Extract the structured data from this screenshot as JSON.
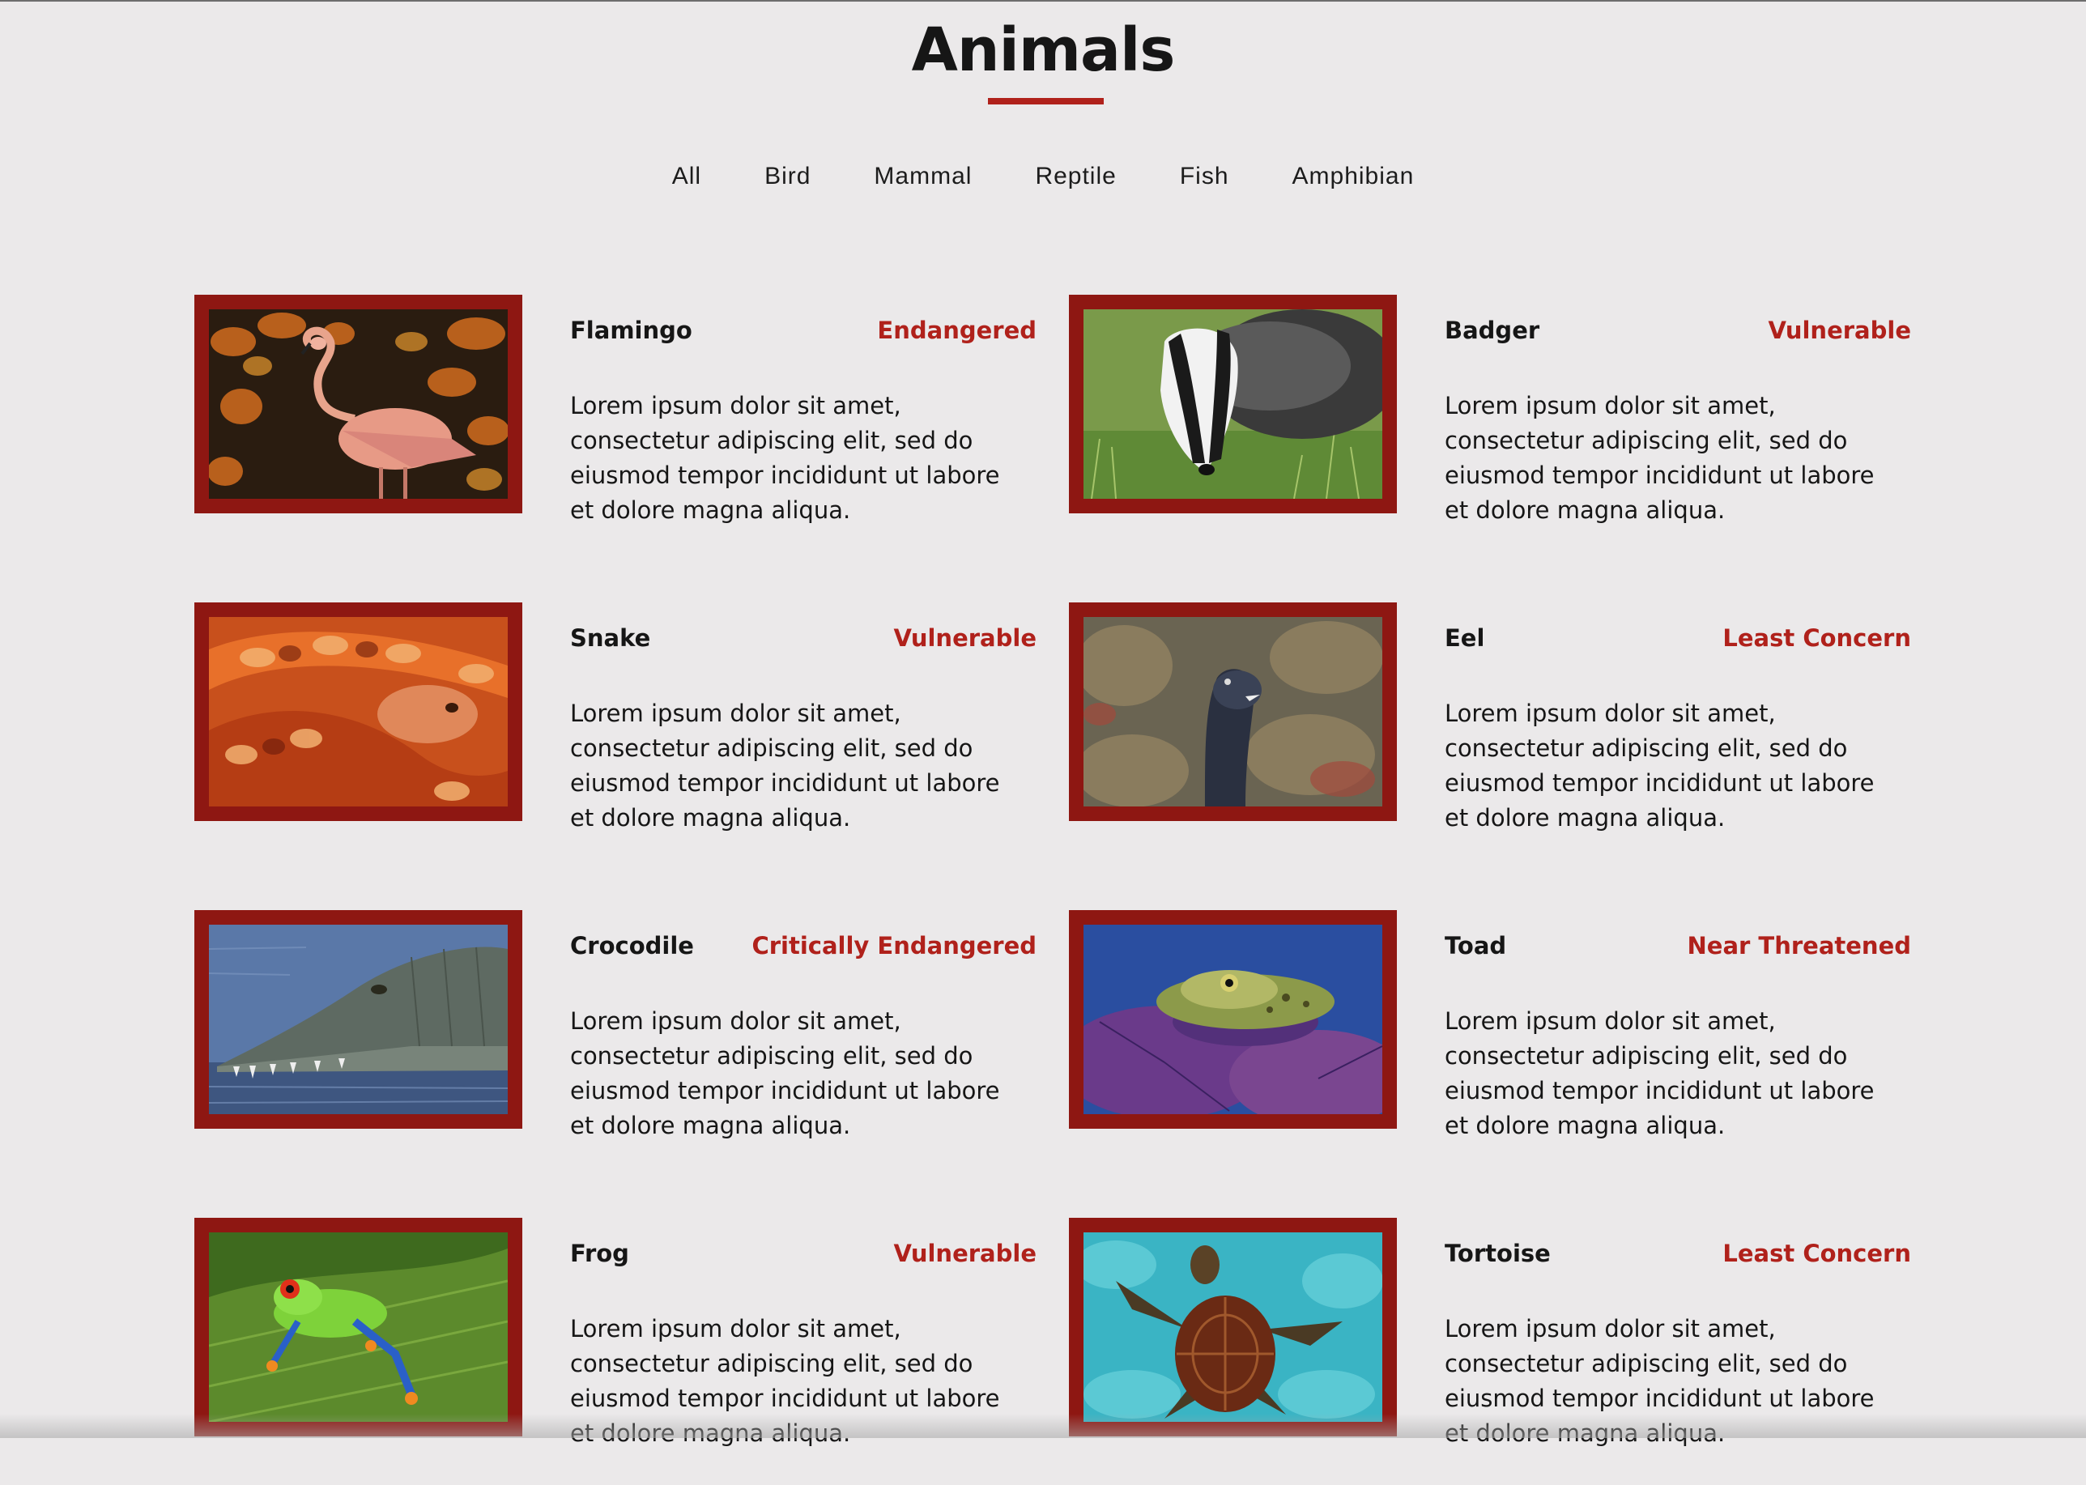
{
  "page": {
    "title": "Animals",
    "accent_color": "#b0211b",
    "frame_color": "#8e1712",
    "background_color": "#ebe9ea"
  },
  "filters": [
    {
      "label": "All"
    },
    {
      "label": "Bird"
    },
    {
      "label": "Mammal"
    },
    {
      "label": "Reptile"
    },
    {
      "label": "Fish"
    },
    {
      "label": "Amphibian"
    }
  ],
  "animals": [
    {
      "name": "Flamingo",
      "status": "Endangered",
      "description": "Lorem ipsum dolor sit amet, consectetur adipiscing elit, sed do eiusmod tempor incididunt ut labore et dolore magna aliqua.",
      "image": "flamingo-photo"
    },
    {
      "name": "Badger",
      "status": "Vulnerable",
      "description": "Lorem ipsum dolor sit amet, consectetur adipiscing elit, sed do eiusmod tempor incididunt ut labore et dolore magna aliqua.",
      "image": "badger-photo"
    },
    {
      "name": "Snake",
      "status": "Vulnerable",
      "description": "Lorem ipsum dolor sit amet, consectetur adipiscing elit, sed do eiusmod tempor incididunt ut labore et dolore magna aliqua.",
      "image": "snake-photo"
    },
    {
      "name": "Eel",
      "status": "Least Concern",
      "description": "Lorem ipsum dolor sit amet, consectetur adipiscing elit, sed do eiusmod tempor incididunt ut labore et dolore magna aliqua.",
      "image": "eel-photo"
    },
    {
      "name": "Crocodile",
      "status": "Critically Endangered",
      "description": "Lorem ipsum dolor sit amet, consectetur adipiscing elit, sed do eiusmod tempor incididunt ut labore et dolore magna aliqua.",
      "image": "crocodile-photo"
    },
    {
      "name": "Toad",
      "status": "Near Threatened",
      "description": "Lorem ipsum dolor sit amet, consectetur adipiscing elit, sed do eiusmod tempor incididunt ut labore et dolore magna aliqua.",
      "image": "toad-photo"
    },
    {
      "name": "Frog",
      "status": "Vulnerable",
      "description": "Lorem ipsum dolor sit amet, consectetur adipiscing elit, sed do eiusmod tempor incididunt ut labore et dolore magna aliqua.",
      "image": "frog-photo"
    },
    {
      "name": "Tortoise",
      "status": "Least Concern",
      "description": "Lorem ipsum dolor sit amet, consectetur adipiscing elit, sed do eiusmod tempor incididunt ut labore et dolore magna aliqua.",
      "image": "tortoise-photo"
    }
  ]
}
